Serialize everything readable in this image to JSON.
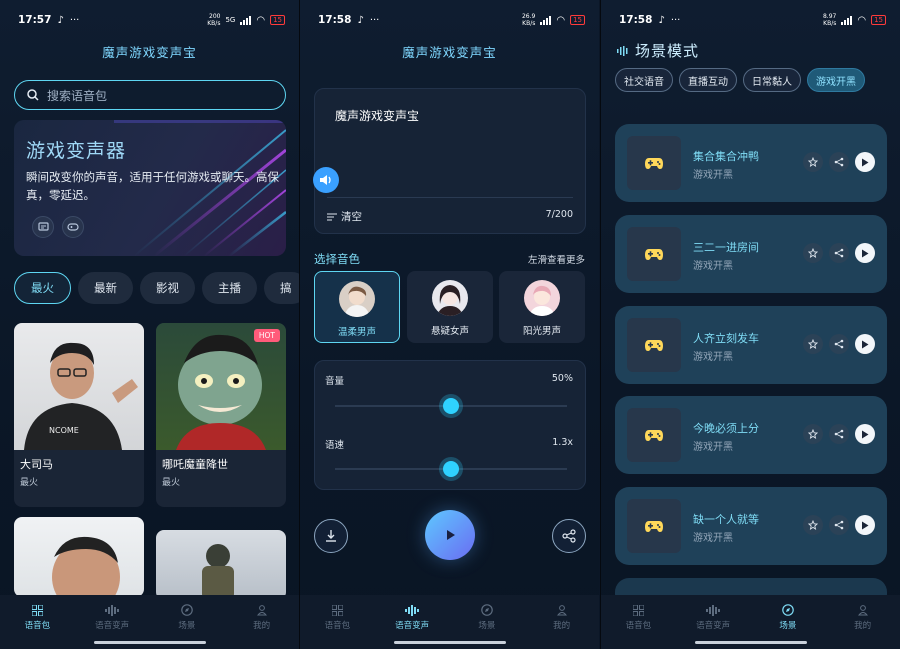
{
  "status": [
    {
      "time": "17:57",
      "net": [
        "200",
        "KB/s"
      ],
      "battery": "15"
    },
    {
      "time": "17:58",
      "net": [
        "26.9",
        "KB/s"
      ],
      "battery": "15"
    },
    {
      "time": "17:58",
      "net": [
        "8.97",
        "KB/s"
      ],
      "battery": "15"
    }
  ],
  "app_title": "魔声游戏变声宝",
  "screen1": {
    "search_placeholder": "搜索语音包",
    "banner": {
      "title": "游戏变声器",
      "desc": "瞬间改变你的声音，适用于任何游戏或聊天。高保真，零延迟。"
    },
    "tabs": [
      "最火",
      "最新",
      "影视",
      "主播",
      "搞"
    ],
    "cards": [
      {
        "name": "大司马",
        "tag": "最火"
      },
      {
        "name": "哪吒魔童降世",
        "tag": "最火",
        "badge": "HOT"
      }
    ]
  },
  "screen2": {
    "text": "魔声游戏变声宝",
    "clear_label": "清空",
    "counter": "7/200",
    "voice_title": "选择音色",
    "voice_hint": "左滑查看更多",
    "voices": [
      "温柔男声",
      "悬疑女声",
      "阳光男声"
    ],
    "volume_label": "音量",
    "volume_value": "50%",
    "volume_level": 0.5,
    "speed_label": "语速",
    "speed_value": "1.3x",
    "speed_level": 0.5
  },
  "screen3": {
    "title": "场景模式",
    "chips": [
      "社交语音",
      "直播互动",
      "日常黏人",
      "游戏开黑"
    ],
    "items": [
      {
        "title": "集合集合冲鸭",
        "sub": "游戏开黑"
      },
      {
        "title": "三二一进房间",
        "sub": "游戏开黑"
      },
      {
        "title": "人齐立刻发车",
        "sub": "游戏开黑"
      },
      {
        "title": "今晚必须上分",
        "sub": "游戏开黑"
      },
      {
        "title": "缺一个人就等",
        "sub": "游戏开黑"
      }
    ]
  },
  "nav": [
    "语音包",
    "语音变声",
    "场景",
    "我的"
  ],
  "colors": {
    "accent": "#5ed6f2",
    "bg": "#0b1727",
    "card": "#1f4159"
  }
}
